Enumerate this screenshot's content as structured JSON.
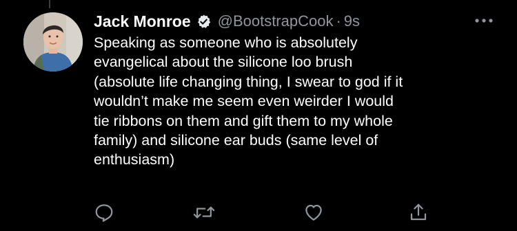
{
  "tweet": {
    "author": {
      "name": "Jack Monroe",
      "handle": "@BootstrapCook",
      "verified": true,
      "avatar_icon": "profile-photo"
    },
    "separator": "·",
    "time": "9s",
    "text_lines": [
      "Speaking as someone who is absolutely",
      "evangelical about the silicone loo brush",
      "(absolute life changing thing, I swear to god if it",
      "wouldn’t make me seem even weirder I would",
      "tie ribbons on them and gift them to my whole",
      "family) and silicone ear buds (same level of",
      "enthusiasm)"
    ]
  },
  "actions": {
    "reply_icon": "reply-icon",
    "retweet_icon": "retweet-icon",
    "like_icon": "heart-icon",
    "share_icon": "share-icon"
  },
  "colors": {
    "background": "#000000",
    "text": "#ffffff",
    "secondary": "#8f969c",
    "icon": "#8f969c"
  }
}
